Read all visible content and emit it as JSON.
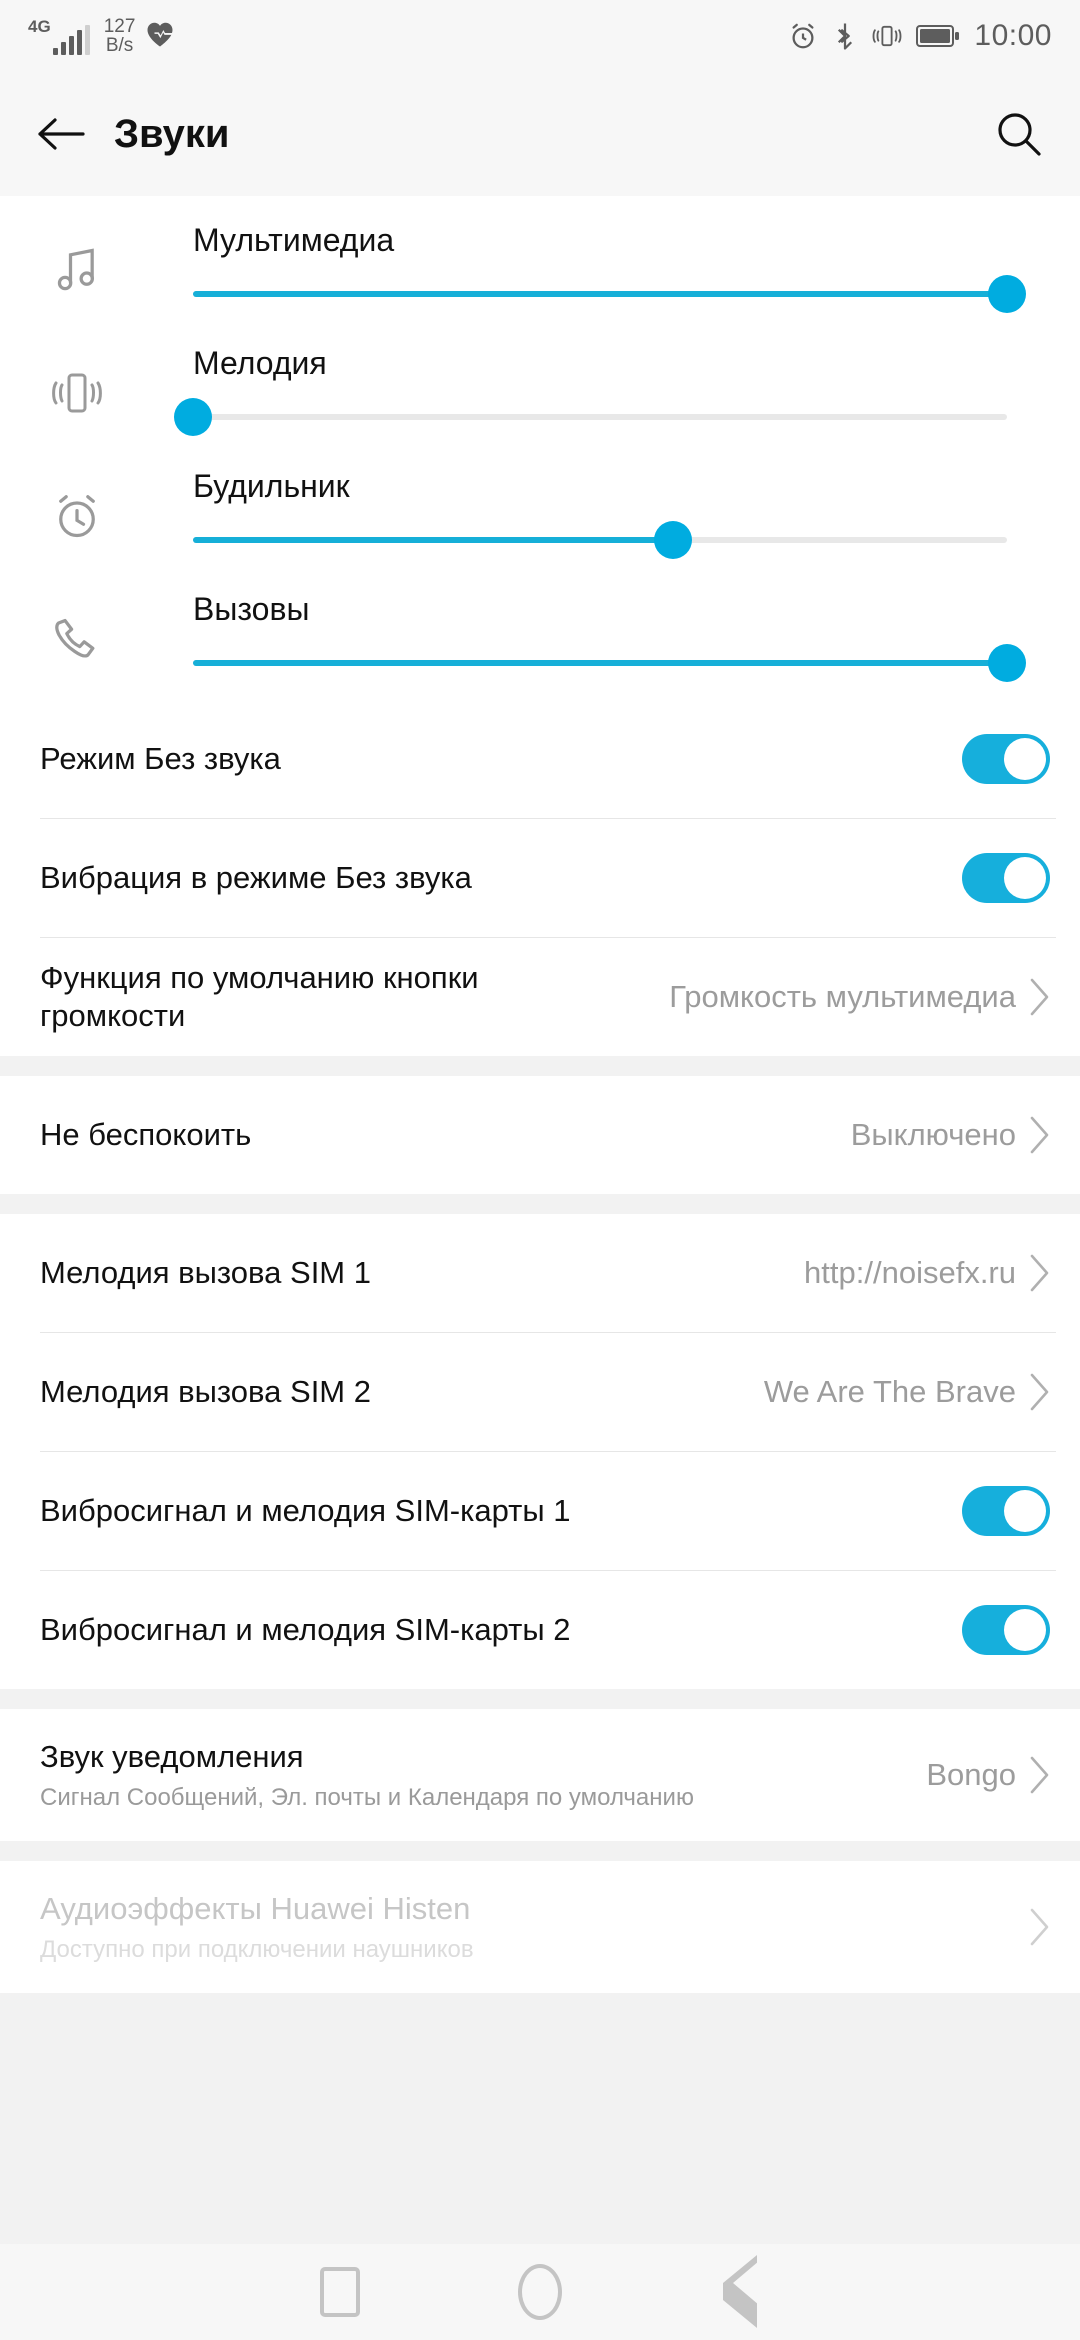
{
  "statusbar": {
    "network_type": "4G",
    "net_speed_value": "127",
    "net_speed_unit": "B/s",
    "time": "10:00",
    "icons": [
      "signal-icon",
      "heartbeat-icon",
      "alarm-icon",
      "bluetooth-icon",
      "vibrate-icon",
      "battery-icon"
    ]
  },
  "appbar": {
    "title": "Звуки",
    "back_icon": "back-arrow-icon",
    "search_icon": "search-icon"
  },
  "sliders": [
    {
      "icon": "music-note-icon",
      "label": "Мультимедиа",
      "value": 100
    },
    {
      "icon": "vibrate-icon",
      "label": "Мелодия",
      "value": 0
    },
    {
      "icon": "alarm-clock-icon",
      "label": "Будильник",
      "value": 59
    },
    {
      "icon": "phone-call-icon",
      "label": "Вызовы",
      "value": 100
    }
  ],
  "section_toggles": [
    {
      "title": "Режим Без звука",
      "state": "on"
    },
    {
      "title": "Вибрация в режиме Без звука",
      "state": "on"
    }
  ],
  "volume_button": {
    "title": "Функция по умолчанию кнопки громкости",
    "value": "Громкость мультимедиа"
  },
  "dnd": {
    "title": "Не беспокоить",
    "value": "Выключено"
  },
  "ringtones": [
    {
      "title": "Мелодия вызова SIM 1",
      "value": "http://noisefx.ru"
    },
    {
      "title": "Мелодия вызова SIM 2",
      "value": "We Are The Brave"
    }
  ],
  "sim_vibration": [
    {
      "title": "Вибросигнал и мелодия SIM-карты 1",
      "state": "on"
    },
    {
      "title": "Вибросигнал и мелодия SIM-карты 2",
      "state": "on"
    }
  ],
  "notification": {
    "title": "Звук уведомления",
    "subtitle": "Сигнал Сообщений, Эл. почты и Календаря по умолчанию",
    "value": "Bongo"
  },
  "histen": {
    "title": "Аудиоэффекты Huawei Histen",
    "subtitle": "Доступно при подключении наушников"
  },
  "navbar": {
    "recent_label": "recents-button",
    "home_label": "home-button",
    "back_label": "back-button"
  },
  "colors": {
    "accent": "#16afd8",
    "thumb": "#00ace0",
    "toggle_on": "#16afdc",
    "header_bg": "#f7f7f7",
    "section_gap": "#f2f2f2"
  }
}
